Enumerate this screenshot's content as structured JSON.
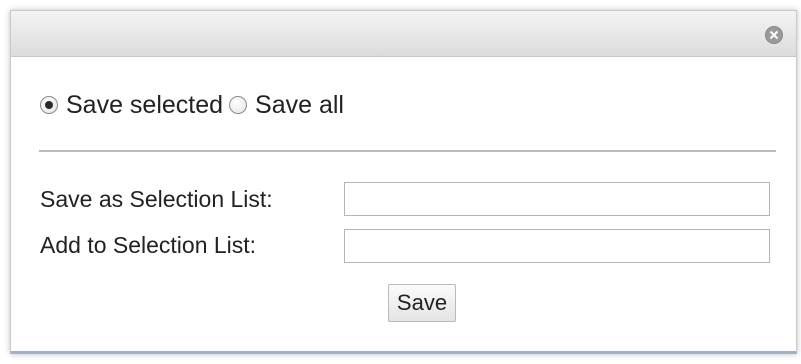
{
  "dialog": {
    "close_icon": "close-circle-icon"
  },
  "save_mode": {
    "options": [
      {
        "label": "Save selected",
        "checked": true
      },
      {
        "label": "Save all",
        "checked": false
      }
    ]
  },
  "form": {
    "save_as_label": "Save as Selection List:",
    "save_as_value": "",
    "add_to_label": "Add to Selection List:",
    "add_to_value": "",
    "save_button_label": "Save"
  }
}
